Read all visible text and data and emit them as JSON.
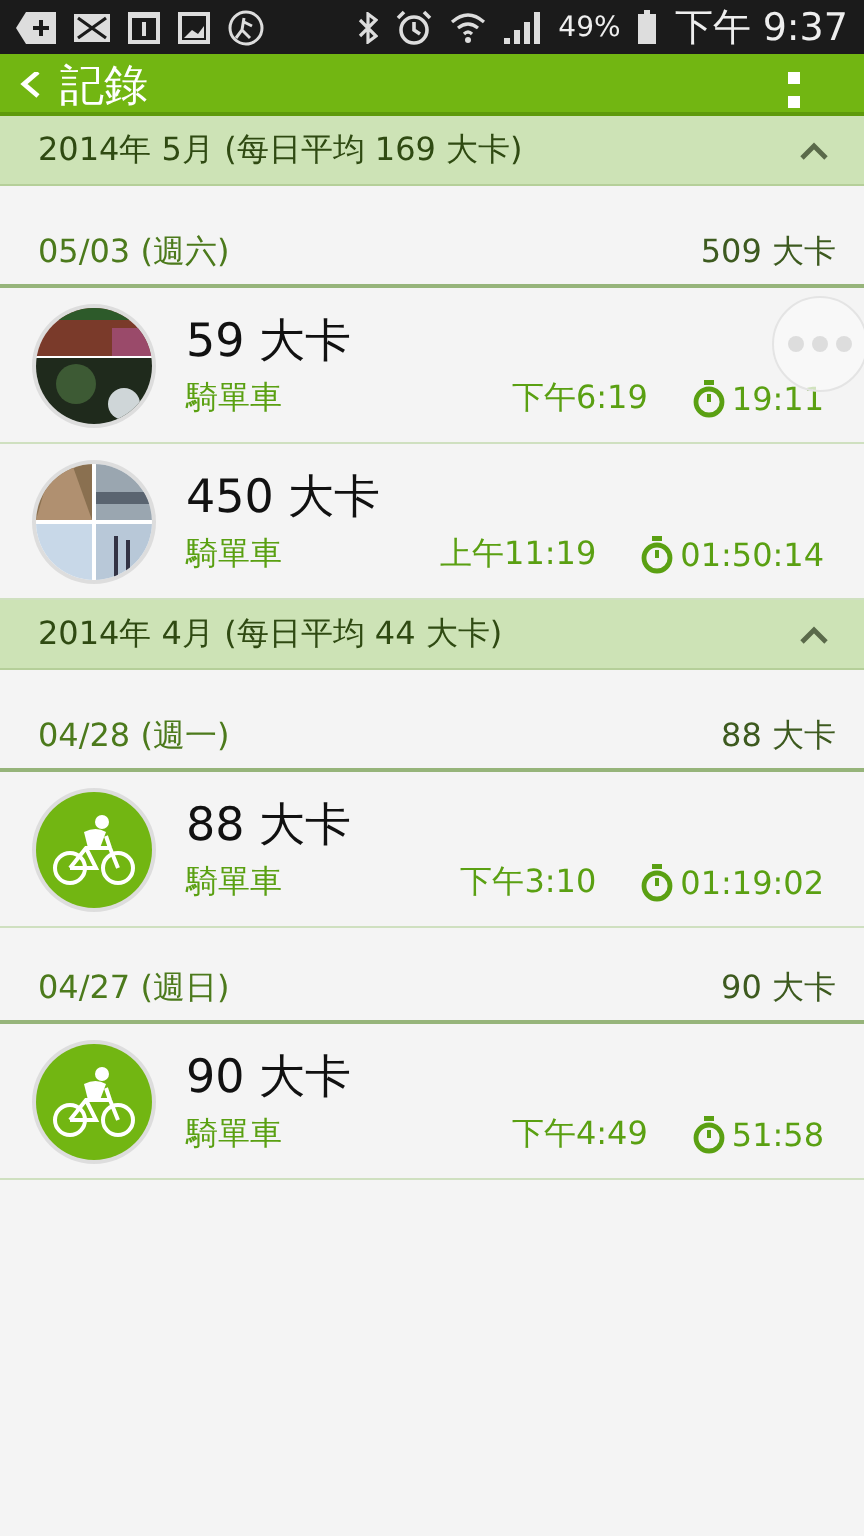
{
  "status_bar": {
    "battery": "49%",
    "time": "下午 9:37"
  },
  "app_bar": {
    "title": "記錄"
  },
  "months": [
    {
      "title": "2014年 5月 (每日平均 169 大卡)",
      "expanded": true,
      "days": [
        {
          "date": "05/03 (週六)",
          "total": "509 大卡",
          "entries": [
            {
              "calories": "59 大卡",
              "activity": "騎單車",
              "start": "下午6:19",
              "duration": "19:11"
            },
            {
              "calories": "450 大卡",
              "activity": "騎單車",
              "start": "上午11:19",
              "duration": "01:50:14"
            }
          ]
        }
      ]
    },
    {
      "title": "2014年 4月 (每日平均 44 大卡)",
      "expanded": true,
      "days": [
        {
          "date": "04/28 (週一)",
          "total": "88 大卡",
          "entries": [
            {
              "kind": "cycling",
              "calories": "88 大卡",
              "activity": "騎單車",
              "start": "下午3:10",
              "duration": "01:19:02"
            }
          ]
        },
        {
          "date": "04/27 (週日)",
          "total": "90 大卡",
          "entries": [
            {
              "kind": "cycling",
              "calories": "90 大卡",
              "activity": "騎單車",
              "start": "下午4:49",
              "duration": "51:58"
            }
          ]
        }
      ]
    }
  ]
}
